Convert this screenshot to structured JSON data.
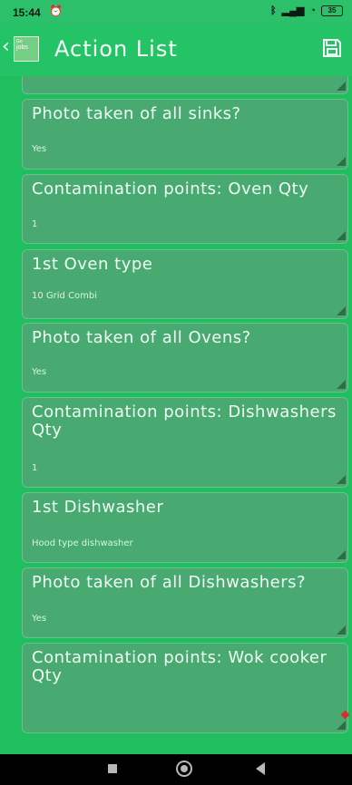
{
  "status_bar": {
    "time": "15:44",
    "left_icon": "alarm-icon",
    "right_icons": [
      "bluetooth-icon",
      "signal-icon",
      "wifi-icon",
      "battery-icon"
    ],
    "battery": "35"
  },
  "app_bar": {
    "logo_small": "Go",
    "logo_main": "jobs",
    "title": "Action List",
    "save_icon": "save-icon",
    "back_icon": "chevron-left-icon"
  },
  "items": [
    {
      "label": "Photo taken of all sinks?",
      "value": "Yes"
    },
    {
      "label": "Contamination points: Oven Qty",
      "value": "1"
    },
    {
      "label": "1st Oven type",
      "value": "10 Grid Combi"
    },
    {
      "label": "Photo taken of all Ovens?",
      "value": "Yes"
    },
    {
      "label": "Contamination points: Dishwashers Qty",
      "value": "1"
    },
    {
      "label": "1st Dishwasher",
      "value": "Hood type dishwasher"
    },
    {
      "label": "Photo taken of all Dishwashers?",
      "value": "Yes"
    },
    {
      "label": "Contamination points: Wok cooker Qty",
      "value": ""
    }
  ],
  "navigation": {
    "recent_apps": "recent-apps-icon",
    "home": "home-icon",
    "back": "back-icon"
  },
  "colors": {
    "screen_background": "#1fbf5f",
    "app_bar": "#24c466",
    "card": "#49aa71",
    "card_border": "#6ebf8e",
    "text": "#eefcf3",
    "nav_bar": "#000000",
    "accent_red": "#d62f2f"
  }
}
